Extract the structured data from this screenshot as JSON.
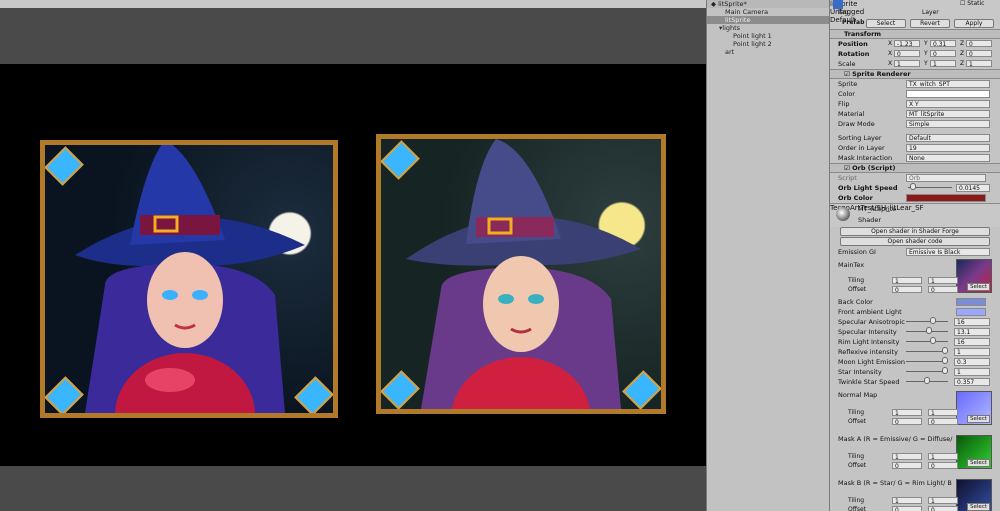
{
  "hierarchy": {
    "scene_title": "litSprite*",
    "items": [
      {
        "label": "Main Camera",
        "indent": 1,
        "selected": false
      },
      {
        "label": "litSprite",
        "indent": 1,
        "selected": true
      },
      {
        "label": "lights",
        "indent": 1,
        "selected": false
      },
      {
        "label": "Point light 1",
        "indent": 3,
        "selected": false
      },
      {
        "label": "Point light 2",
        "indent": 3,
        "selected": false
      },
      {
        "label": "art",
        "indent": 2,
        "selected": false
      }
    ]
  },
  "inspector": {
    "object_name": "litSprite",
    "static_label": "Static",
    "tag_label": "Tag",
    "tag_value": "Untagged",
    "layer_label": "Layer",
    "layer_value": "Default",
    "prefab_label": "Prefab",
    "prefab_buttons": [
      "Select",
      "Revert",
      "Apply"
    ],
    "transform": {
      "title": "Transform",
      "rows": [
        {
          "label": "Position",
          "x": "-1.23",
          "y": "0.31",
          "z": "0"
        },
        {
          "label": "Rotation",
          "x": "0",
          "y": "0",
          "z": "0"
        },
        {
          "label": "Scale",
          "x": "1",
          "y": "1",
          "z": "1"
        }
      ]
    },
    "sprite_renderer": {
      "title": "Sprite Renderer",
      "rows": [
        {
          "label": "Sprite",
          "value": "TX_witch_SPT"
        },
        {
          "label": "Color",
          "value": ""
        },
        {
          "label": "Flip",
          "value": "X  Y"
        },
        {
          "label": "Material",
          "value": "MT_litSprite"
        },
        {
          "label": "Draw Mode",
          "value": "Simple"
        },
        {
          "label": "Sorting Layer",
          "value": "Default"
        },
        {
          "label": "Order in Layer",
          "value": "19"
        },
        {
          "label": "Mask Interaction",
          "value": "None"
        }
      ]
    },
    "orb_script": {
      "title": "Orb (Script)",
      "script_label": "Script",
      "script_value": "Orb",
      "speed_label": "Orb Light Speed",
      "speed_value": "0.0145",
      "color_label": "Orb Color",
      "color_hex": "#8b1a1a"
    },
    "material": {
      "name": "MT_litSprite",
      "shader_label": "Shader",
      "shader_value": "TecnoArtTest/SH_litLear_SF",
      "btn_shader_forge": "Open shader in Shader Forge",
      "btn_shader_code": "Open shader code",
      "emission_label": "Emission GI",
      "emission_value": "Emissive Is Black",
      "maintex_label": "MainTex",
      "tiling_label": "Tiling",
      "offset_label": "Offset",
      "select_label": "Select",
      "tex_slots": [
        {
          "label": "MainTex",
          "tiling": [
            "1",
            "1"
          ],
          "offset": [
            "0",
            "0"
          ]
        },
        {
          "label": "Normal Map",
          "tiling": [
            "1",
            "1"
          ],
          "offset": [
            "0",
            "0"
          ]
        },
        {
          "label": "Mask A (R = Emissive/ G = Diffuse/",
          "tiling": [
            "1",
            "1"
          ],
          "offset": [
            "0",
            "0"
          ]
        },
        {
          "label": "Mask B (R = Star/ G = Rim Light/ B",
          "tiling": [
            "1",
            "1"
          ],
          "offset": [
            "0",
            "0"
          ]
        }
      ],
      "back_color_label": "Back Color",
      "front_ambient_label": "Front ambient Light",
      "sliders": [
        {
          "label": "Specular Anisotropic",
          "value": "16",
          "fill": 0.68
        },
        {
          "label": "Specular Intensity",
          "value": "13.1",
          "fill": 0.55
        },
        {
          "label": "Rim Light Intensity",
          "value": "16",
          "fill": 0.68
        },
        {
          "label": "Reflexive intensity",
          "value": "1",
          "fill": 1.0
        },
        {
          "label": "Moon Light Emission",
          "value": "0.3",
          "fill": 1.0
        },
        {
          "label": "Star Intensity",
          "value": "1",
          "fill": 1.0
        },
        {
          "label": "Twinkle Star Speed",
          "value": "0.357",
          "fill": 0.5
        }
      ]
    }
  },
  "colors": {
    "accent_red": "#8b1a1a",
    "viewport_bg": "#000000",
    "panel_bg": "#c2c2c2",
    "selection": "#8c8c8c",
    "back_color": "#7a8ed8",
    "front_ambient": "#9aa6ff"
  }
}
